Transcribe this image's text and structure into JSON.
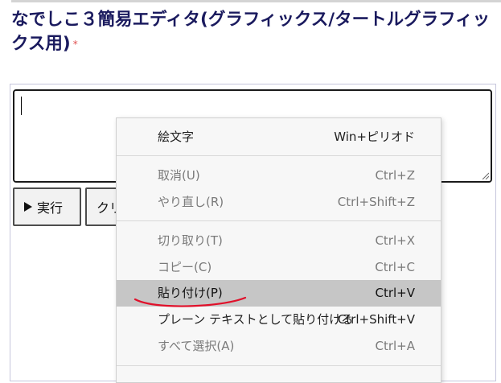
{
  "page": {
    "title": "なでしこ３簡易エディタ(グラフィックス/タートルグラフィックス用)",
    "required_mark": "*"
  },
  "editor": {
    "value": ""
  },
  "buttons": {
    "run_label": "実行",
    "clear_label": "クリア"
  },
  "context_menu": {
    "items": [
      {
        "label": "絵文字",
        "shortcut": "Win+ピリオド",
        "state": "enabled"
      },
      {
        "label": "取消(U)",
        "shortcut": "Ctrl+Z",
        "state": "disabled"
      },
      {
        "label": "やり直し(R)",
        "shortcut": "Ctrl+Shift+Z",
        "state": "disabled"
      },
      {
        "label": "切り取り(T)",
        "shortcut": "Ctrl+X",
        "state": "disabled"
      },
      {
        "label": "コピー(C)",
        "shortcut": "Ctrl+C",
        "state": "disabled"
      },
      {
        "label": "貼り付け(P)",
        "shortcut": "Ctrl+V",
        "state": "highlighted"
      },
      {
        "label": "プレーン テキストとして貼り付ける",
        "shortcut": "Ctrl+Shift+V",
        "state": "enabled"
      },
      {
        "label": "すべて選択(A)",
        "shortcut": "Ctrl+A",
        "state": "disabled"
      }
    ]
  },
  "colors": {
    "title": "#1a1a5e",
    "menu_highlight": "#c6c6c6",
    "annotation_underline": "#e0102a"
  }
}
